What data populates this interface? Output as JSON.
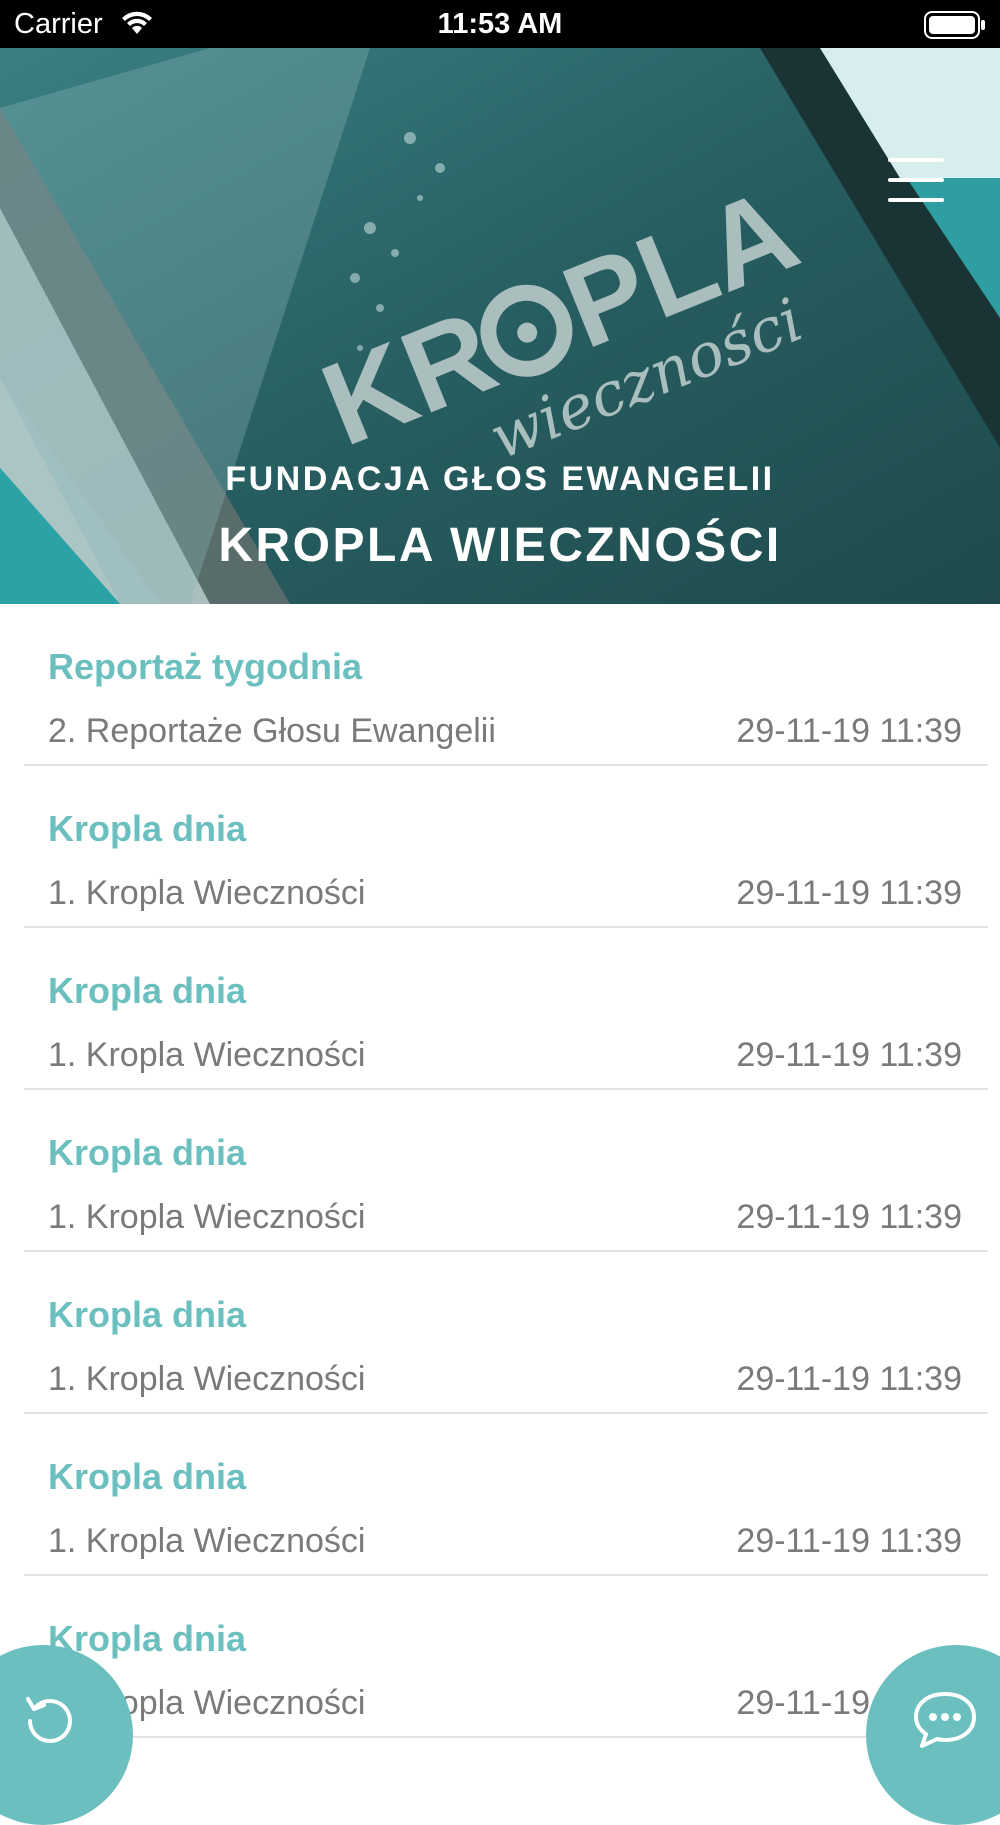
{
  "status_bar": {
    "carrier": "Carrier",
    "time": "11:53 AM"
  },
  "hero": {
    "logo_text": "KR",
    "logo_text_2": "PLA",
    "logo_script": "wieczności",
    "title": "FUNDACJA GŁOS EWANGELII",
    "subtitle": "KROPLA WIECZNOŚCI"
  },
  "feed": {
    "items": [
      {
        "category": "Reportaż tygodnia",
        "title": "2. Reportaże Głosu Ewangelii",
        "date": "29-11-19 11:39"
      },
      {
        "category": "Kropla dnia",
        "title": "1. Kropla Wieczności",
        "date": "29-11-19 11:39"
      },
      {
        "category": "Kropla dnia",
        "title": "1. Kropla Wieczności",
        "date": "29-11-19 11:39"
      },
      {
        "category": "Kropla dnia",
        "title": "1. Kropla Wieczności",
        "date": "29-11-19 11:39"
      },
      {
        "category": "Kropla dnia",
        "title": "1. Kropla Wieczności",
        "date": "29-11-19 11:39"
      },
      {
        "category": "Kropla dnia",
        "title": "1. Kropla Wieczności",
        "date": "29-11-19 11:39"
      },
      {
        "category": "Kropla dnia",
        "title": "1. Kropla Wieczności",
        "date": "29-11-19 11:39"
      }
    ]
  },
  "buttons": {
    "refresh_icon": "refresh-icon",
    "chat_icon": "chat-bubble-icon",
    "menu_icon": "hamburger-menu-icon"
  },
  "colors": {
    "accent": "#6bbfbf",
    "text_secondary": "#7a7a7a",
    "hero_dark": "#1f4f52"
  }
}
